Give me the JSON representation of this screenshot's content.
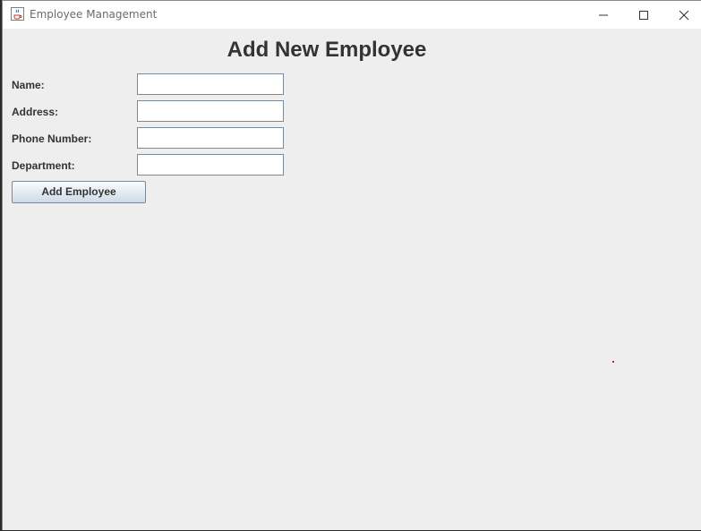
{
  "window": {
    "title": "Employee Management",
    "icon": "java-cup-icon"
  },
  "form": {
    "heading": "Add New Employee",
    "fields": [
      {
        "label": "Name:",
        "value": "",
        "placeholder": ""
      },
      {
        "label": "Address:",
        "value": "",
        "placeholder": ""
      },
      {
        "label": "Phone Number:",
        "value": "",
        "placeholder": ""
      },
      {
        "label": "Department:",
        "value": "",
        "placeholder": ""
      }
    ],
    "submit_label": "Add Employee"
  },
  "colors": {
    "window_bg": "#eeeeee",
    "titlebar_bg": "#ffffff",
    "text": "#333333",
    "input_border": "#7a8a99"
  }
}
